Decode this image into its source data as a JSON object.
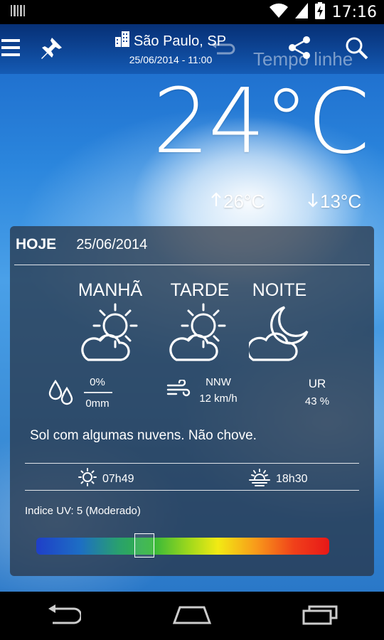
{
  "status_bar": {
    "time": "17:16"
  },
  "header": {
    "city": "São Paulo, SP",
    "datetime": "25/06/2014 - 11:00",
    "watermark": "Tempo linhe"
  },
  "current": {
    "temperature": "24°C",
    "max": "26°C",
    "min": "13°C"
  },
  "today": {
    "label": "HOJE",
    "date": "25/06/2014",
    "periods": [
      {
        "label": "MANHÃ",
        "icon": "partly-cloudy-icon"
      },
      {
        "label": "TARDE",
        "icon": "partly-cloudy-icon"
      },
      {
        "label": "NOITE",
        "icon": "night-cloudy-icon"
      }
    ],
    "rain": {
      "probability": "0%",
      "amount": "0mm"
    },
    "wind": {
      "direction": "NNW",
      "speed": "12 km/h"
    },
    "humidity": {
      "label": "UR",
      "value": "43 %"
    },
    "description": "Sol com algumas nuvens. Não chove.",
    "sunrise": "07h49",
    "sunset": "18h30",
    "uv": {
      "label": "Indice UV:",
      "value": "5 (Moderado)",
      "level_fraction": 0.37
    }
  },
  "colors": {
    "card_bg": "#28323f",
    "uv_low": "#1f3fc8",
    "uv_high": "#e81818"
  }
}
